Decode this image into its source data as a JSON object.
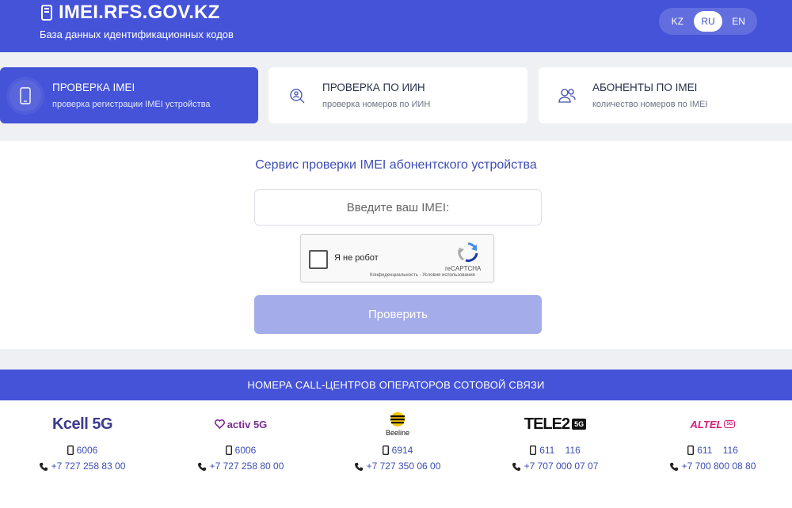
{
  "header": {
    "site_title": "IMEI.RFS.GOV.KZ",
    "subtitle": "База данных идентификационных кодов",
    "languages": [
      "KZ",
      "RU",
      "EN"
    ],
    "active_language": "RU"
  },
  "tabs": [
    {
      "title": "ПРОВЕРКА IMEI",
      "subtitle": "проверка регистрации IMEI устройства",
      "active": true,
      "icon": "phone-icon"
    },
    {
      "title": "ПРОВЕРКА ПО ИИН",
      "subtitle": "проверка номеров по ИИН",
      "active": false,
      "icon": "user-search-icon"
    },
    {
      "title": "АБОНЕНТЫ ПО IMEI",
      "subtitle": "количество номеров по IMEI",
      "active": false,
      "icon": "users-icon"
    }
  ],
  "main": {
    "service_title": "Сервис проверки IMEI абонентского устройства",
    "imei_placeholder": "Введите ваш IMEI:",
    "imei_value": "",
    "captcha_label": "Я не робот",
    "captcha_brand": "reCAPTCHA",
    "captcha_links": "Конфиденциальность - Условия использования",
    "submit_label": "Проверить"
  },
  "call_centers": {
    "title": "НОМЕРА CALL-ЦЕНТРОВ ОПЕРАТОРОВ СОТОВОЙ СВЯЗИ",
    "operators": [
      {
        "name": "Kcell",
        "badge": "5G",
        "short": "6006",
        "phone": "+7 727 258 83 00"
      },
      {
        "name": "activ",
        "badge": "5G",
        "short": "6006",
        "phone": "+7 727 258 80 00"
      },
      {
        "name": "Beeline",
        "short": "6914",
        "phone": "+7 727 350 06 00"
      },
      {
        "name": "TELE2",
        "badge": "5G",
        "short": "611    116",
        "phone": "+7 707 000 07 07"
      },
      {
        "name": "ALTEL",
        "badge": "5G",
        "short": "611    116",
        "phone": "+7 700 800 08 80"
      }
    ]
  },
  "colors": {
    "primary": "#4453d8",
    "button_disabled": "#a4acea",
    "link": "#3d4db4"
  }
}
